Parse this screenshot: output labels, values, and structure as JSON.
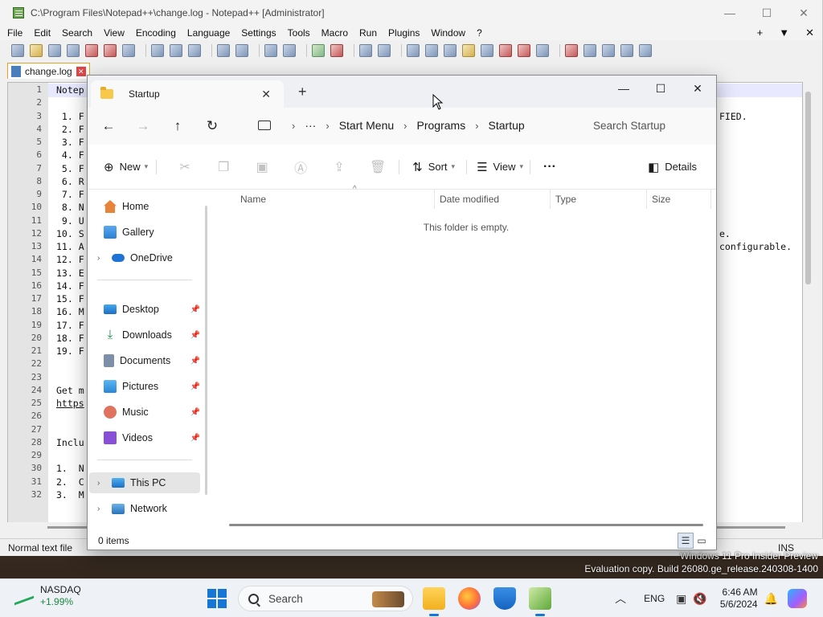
{
  "notepad": {
    "title": "C:\\Program Files\\Notepad++\\change.log - Notepad++ [Administrator]",
    "menu": [
      "File",
      "Edit",
      "Search",
      "View",
      "Encoding",
      "Language",
      "Settings",
      "Tools",
      "Macro",
      "Run",
      "Plugins",
      "Window",
      "?"
    ],
    "menu_right": [
      "+",
      "▼",
      "✕"
    ],
    "tab_label": "change.log",
    "lines": [
      {
        "n": "1",
        "text": "Notep"
      },
      {
        "n": "2",
        "text": ""
      },
      {
        "n": "3",
        "text": " 1. F",
        "tail": "FIED."
      },
      {
        "n": "4",
        "text": " 2. F"
      },
      {
        "n": "5",
        "text": " 3. F"
      },
      {
        "n": "6",
        "text": " 4. F"
      },
      {
        "n": "7",
        "text": " 5. F"
      },
      {
        "n": "8",
        "text": " 6. R"
      },
      {
        "n": "9",
        "text": " 7. F"
      },
      {
        "n": "10",
        "text": " 8. N"
      },
      {
        "n": "11",
        "text": " 9. U"
      },
      {
        "n": "12",
        "text": "10. S",
        "tail": "e."
      },
      {
        "n": "13",
        "text": "11. A",
        "tail": "configurable."
      },
      {
        "n": "14",
        "text": "12. F"
      },
      {
        "n": "15",
        "text": "13. E"
      },
      {
        "n": "16",
        "text": "14. F"
      },
      {
        "n": "17",
        "text": "15. F"
      },
      {
        "n": "18",
        "text": "16. M"
      },
      {
        "n": "19",
        "text": "17. F"
      },
      {
        "n": "20",
        "text": "18. F"
      },
      {
        "n": "21",
        "text": "19. F"
      },
      {
        "n": "22",
        "text": ""
      },
      {
        "n": "23",
        "text": ""
      },
      {
        "n": "24",
        "text": "Get m"
      },
      {
        "n": "25",
        "text": "https"
      },
      {
        "n": "26",
        "text": ""
      },
      {
        "n": "27",
        "text": ""
      },
      {
        "n": "28",
        "text": "Inclu"
      },
      {
        "n": "29",
        "text": ""
      },
      {
        "n": "30",
        "text": "1.  N"
      },
      {
        "n": "31",
        "text": "2.  C"
      },
      {
        "n": "32",
        "text": "3.  M"
      }
    ],
    "status_type": "Normal text file",
    "status_mode": "INS"
  },
  "explorer": {
    "tab_title": "Startup",
    "breadcrumb": [
      "Start Menu",
      "Programs",
      "Startup"
    ],
    "ellipsis": "···",
    "search_placeholder": "Search Startup",
    "toolbar": {
      "new": "New",
      "sort": "Sort",
      "view": "View",
      "more": "···",
      "details": "Details"
    },
    "nav": {
      "home": "Home",
      "gallery": "Gallery",
      "onedrive": "OneDrive",
      "desktop": "Desktop",
      "downloads": "Downloads",
      "documents": "Documents",
      "pictures": "Pictures",
      "music": "Music",
      "videos": "Videos",
      "thispc": "This PC",
      "network": "Network"
    },
    "columns": [
      "Name",
      "Date modified",
      "Type",
      "Size"
    ],
    "empty_message": "This folder is empty.",
    "status": "0 items"
  },
  "watermark": {
    "line1": "Windows 11 Pro Insider Preview",
    "line2": "Evaluation copy. Build 26080.ge_release.240308-1400"
  },
  "taskbar": {
    "ticker_name": "NASDAQ",
    "ticker_change": "+1.99%",
    "search_label": "Search",
    "language": "ENG",
    "time": "6:46 AM",
    "date": "5/6/2024"
  }
}
